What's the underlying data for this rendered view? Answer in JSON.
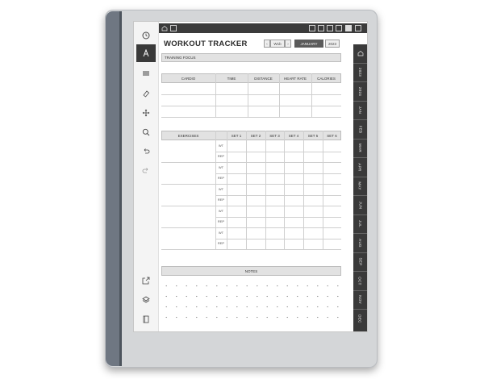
{
  "page": {
    "title": "WORKOUT TRACKER",
    "week_label": "W1b",
    "month_label": "JANUARY",
    "year_label": "2023",
    "training_focus_label": "TRAINING FOCUS",
    "notes_label": "NOTES"
  },
  "cardio_table": {
    "headers": [
      "CARDIO",
      "TIME",
      "DISTANCE",
      "HEART RATE",
      "CALORIES"
    ],
    "rows": 3
  },
  "exercise_table": {
    "headers": [
      "EXERCISES",
      "SET 1",
      "SET 2",
      "SET 3",
      "SET 4",
      "SET 5",
      "SET 6"
    ],
    "row_labels": [
      "WT",
      "REP"
    ],
    "groups": 5
  },
  "side_tabs": [
    "2023",
    "2024",
    "JAN",
    "FEB",
    "MAR",
    "APR",
    "MAY",
    "JUN",
    "JUL",
    "AUG",
    "SEP",
    "OCT",
    "NOV",
    "DEC"
  ],
  "toolbar": {
    "icons": [
      "menu-circle-icon",
      "pen-icon",
      "lines-icon",
      "eraser-icon",
      "move-icon",
      "zoom-icon",
      "undo-icon",
      "redo-icon",
      "export-icon",
      "layers-icon",
      "page-icon"
    ]
  },
  "topnav": {
    "icons": [
      "home-icon",
      "doc-icon",
      "tab-icon-1",
      "tab-icon-2",
      "tab-icon-3",
      "tab-icon-4",
      "tab-icon-5",
      "tab-icon-6"
    ]
  }
}
